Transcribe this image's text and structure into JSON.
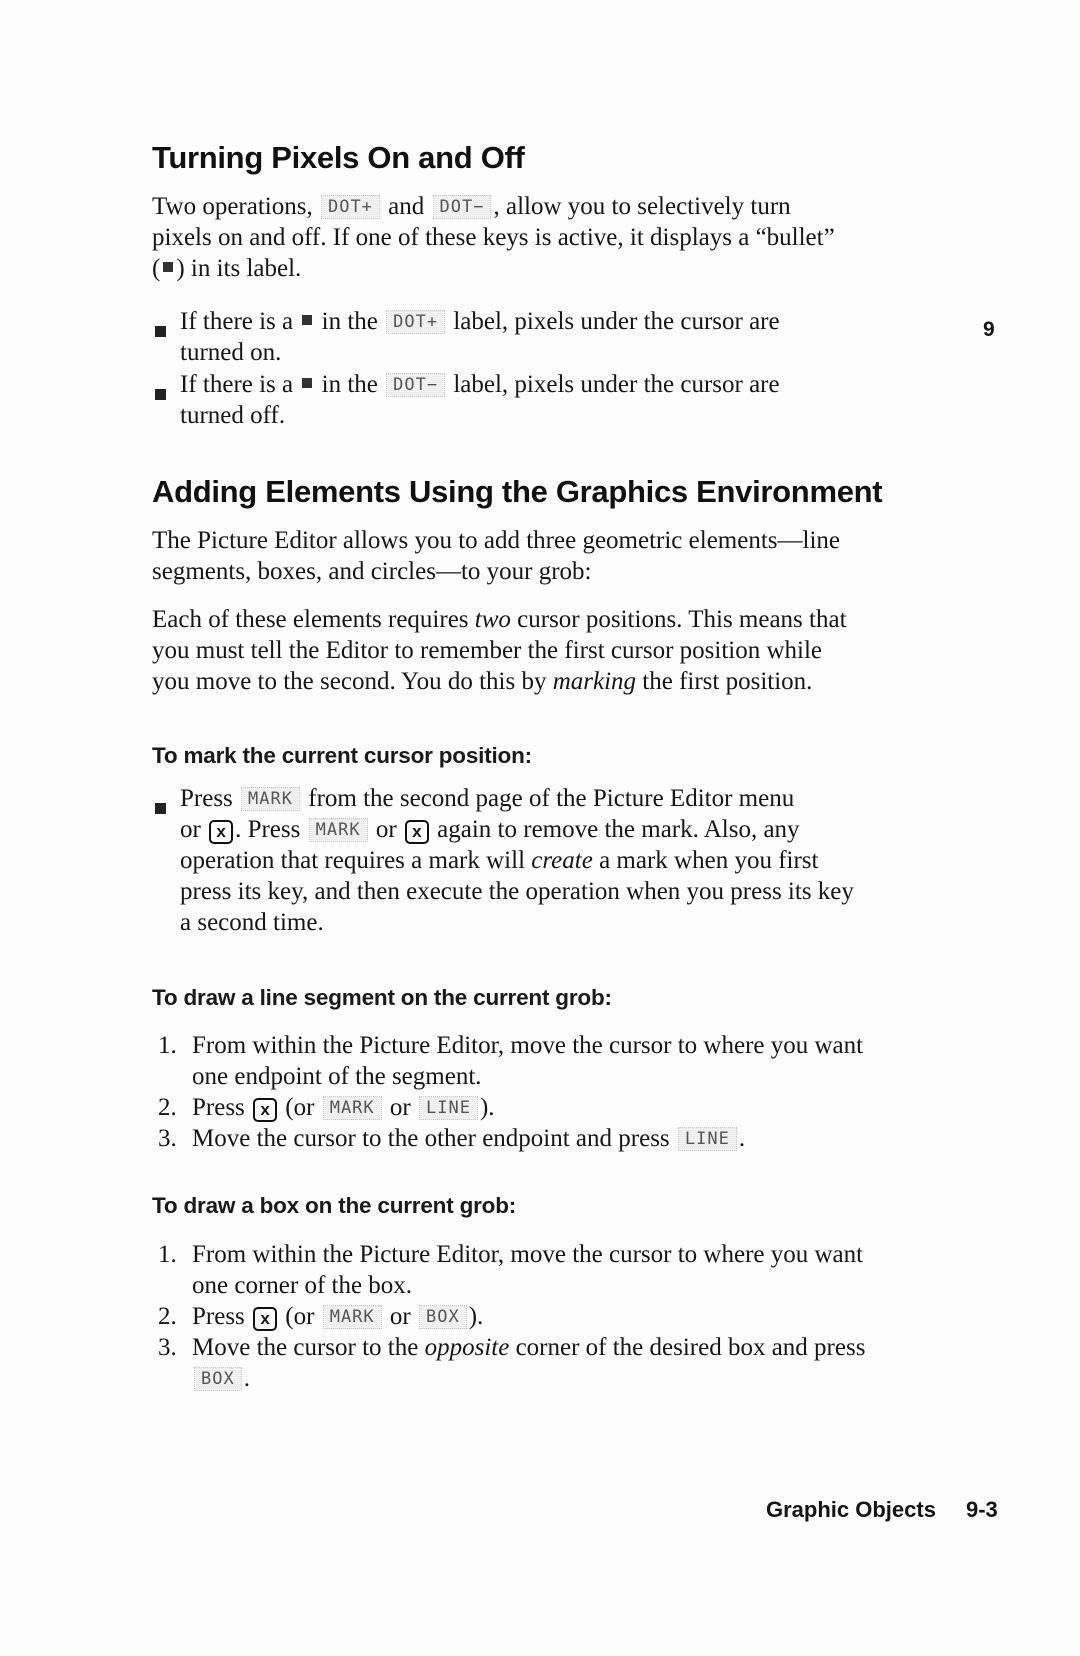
{
  "chapter_tab": "9",
  "section1": {
    "title": "Turning Pixels On and Off",
    "intro": {
      "t1": "Two operations,",
      "key1": "DOT+",
      "t2": "and",
      "key2": "DOT−",
      "t3": ", allow you to selectively turn",
      "line2": "pixels on and off. If one of these keys is active, it displays a “bullet”",
      "line3_a": "(",
      "line3_b": ") in its label."
    },
    "bullets": [
      {
        "a": "If there is a",
        "b": "in the",
        "key": "DOT+",
        "c": "label, pixels under the cursor are",
        "d": "turned on."
      },
      {
        "a": "If there is a",
        "b": "in the",
        "key": "DOT−",
        "c": "label, pixels under the cursor are",
        "d": "turned off."
      }
    ]
  },
  "section2": {
    "title": "Adding Elements Using the Graphics Environment",
    "p1_l1": "The Picture Editor allows you to add three geometric elements—line",
    "p1_l2": "segments, boxes, and circles—to your grob:",
    "p2_l1": "Each of these elements requires",
    "p2_l1_it": "two",
    "p2_l1_end": "cursor positions. This means that",
    "p2_l2": "you must tell the Editor to remember the first cursor position while",
    "p2_l3_a": "you move to the second. You do this by",
    "p2_l3_it": "marking",
    "p2_l3_b": "the first position."
  },
  "mark": {
    "title": "To mark the current cursor position:",
    "l1_a": "Press",
    "l1_key": "MARK",
    "l1_b": "from the second page of the Picture Editor menu",
    "l2_a": "or",
    "l2_b": ". Press",
    "l2_key": "MARK",
    "l2_c": "or",
    "l2_d": "again to remove the mark. Also, any",
    "l3_a": "operation that requires a mark will",
    "l3_it": "create",
    "l3_b": "a mark when you first",
    "l4": "press its key, and then execute the operation when you press its key",
    "l5": "a second time."
  },
  "line": {
    "title": "To draw a line segment on the current grob:",
    "s1_num": "1.",
    "s1_l1": "From within the Picture Editor, move the cursor to where you want",
    "s1_l2": "one endpoint of the segment.",
    "s2_num": "2.",
    "s2_a": "Press",
    "s2_b": "(or",
    "s2_key1": "MARK",
    "s2_c": "or",
    "s2_key2": "LINE",
    "s2_d": ").",
    "s3_num": "3.",
    "s3_a": "Move the cursor to the other endpoint and press",
    "s3_key": "LINE",
    "s3_b": "."
  },
  "box": {
    "title": "To draw a box on the current grob:",
    "s1_num": "1.",
    "s1_l1": "From within the Picture Editor, move the cursor to where you want",
    "s1_l2": "one corner of the box.",
    "s2_num": "2.",
    "s2_a": "Press",
    "s2_b": "(or",
    "s2_key1": "MARK",
    "s2_c": "or",
    "s2_key2": "BOX",
    "s2_d": ").",
    "s3_num": "3.",
    "s3_a": "Move the cursor to the",
    "s3_it": "opposite",
    "s3_b": "corner of the desired box and press",
    "s3_key": "BOX",
    "s3_c": "."
  },
  "keys": {
    "x": "x"
  },
  "footer": {
    "title": "Graphic Objects",
    "page": "9-3"
  }
}
